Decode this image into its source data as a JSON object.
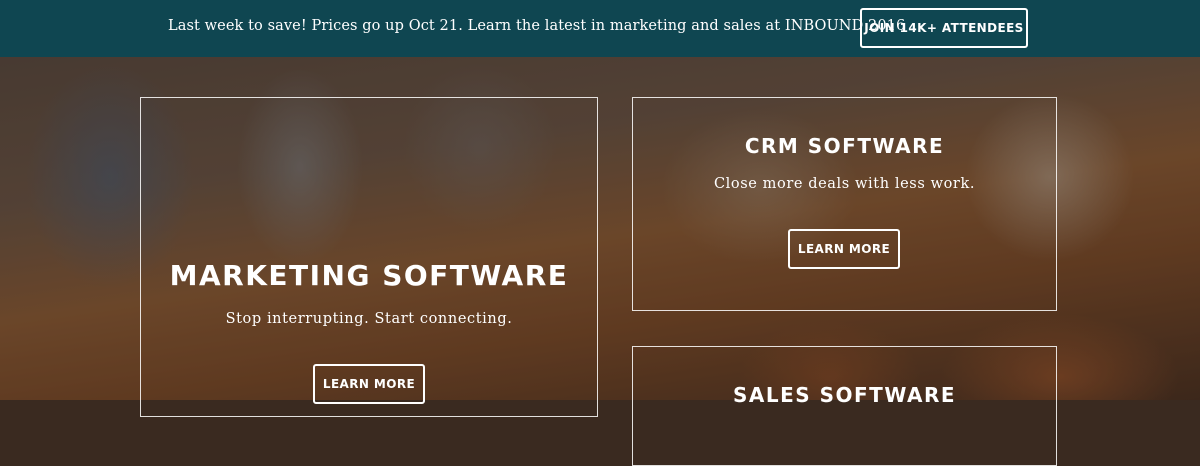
{
  "banner": {
    "text": "Last week to save! Prices go up Oct 21. Learn the latest in marketing and sales at INBOUND 2016",
    "button_label": "JOIN 14K+ ATTENDEES",
    "background_color": "#0f4651"
  },
  "cards": {
    "marketing": {
      "title": "MARKETING SOFTWARE",
      "subtitle": "Stop interrupting. Start connecting.",
      "button_label": "LEARN MORE"
    },
    "crm": {
      "title": "CRM SOFTWARE",
      "subtitle": "Close more deals with less work.",
      "button_label": "LEARN MORE"
    },
    "sales": {
      "title": "SALES SOFTWARE"
    }
  }
}
